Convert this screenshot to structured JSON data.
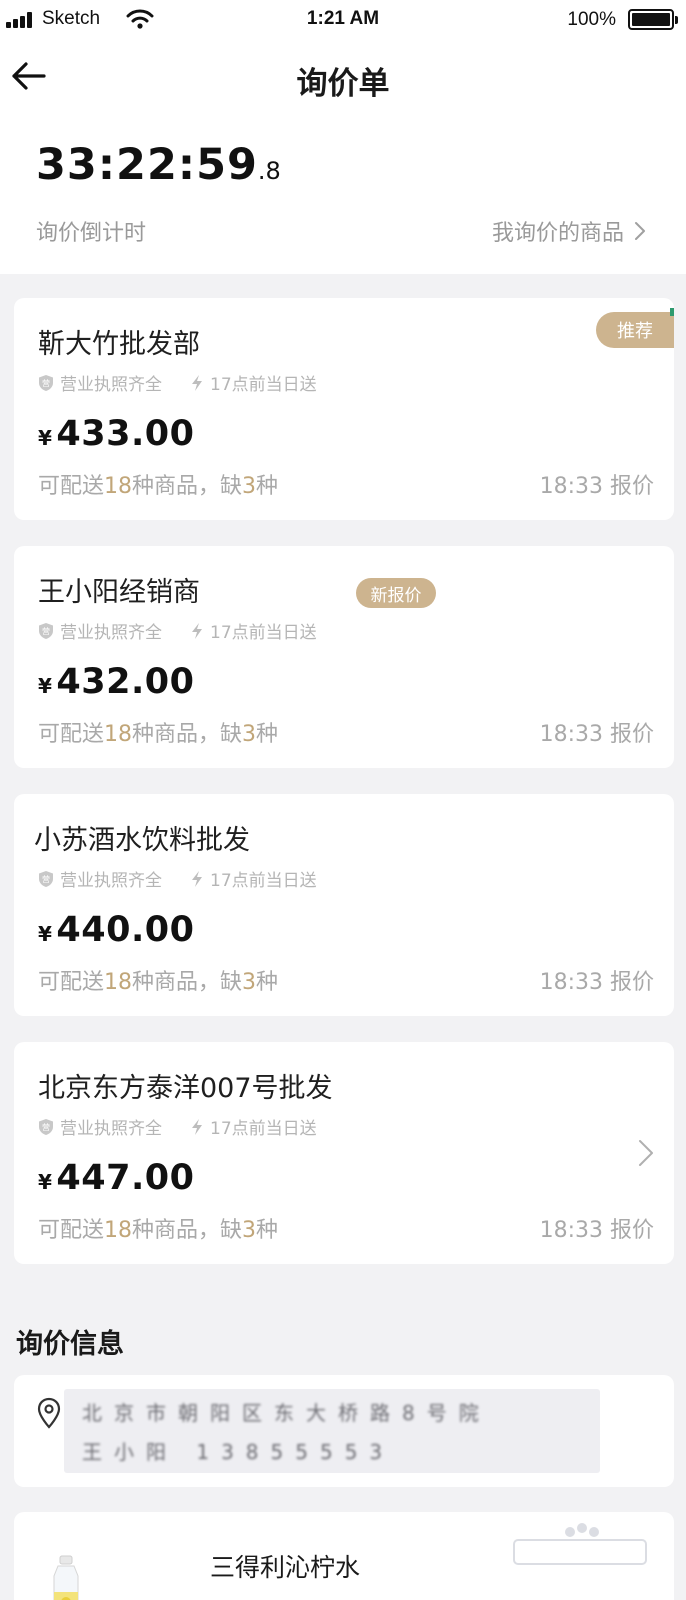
{
  "status_bar": {
    "carrier": "Sketch",
    "time": "1:21 AM",
    "battery": "100%"
  },
  "nav": {
    "title": "询价单"
  },
  "countdown": {
    "main": "33:22:59",
    "fraction": ".8",
    "label": "询价倒计时"
  },
  "my_goods_link": "我询价的商品",
  "suppliers": [
    {
      "name": "靳大竹批发部",
      "tag1": "营业执照齐全",
      "tag2": "17点前当日送",
      "currency": "¥",
      "price": "433.00",
      "delivery_prefix": "可配送",
      "delivery_count": "18",
      "delivery_mid": "种商品，缺",
      "missing_count": "3",
      "delivery_suffix": "种",
      "quote_time": "18:33 报价",
      "badge": "推荐"
    },
    {
      "name": "王小阳经销商",
      "tag1": "营业执照齐全",
      "tag2": "17点前当日送",
      "currency": "¥",
      "price": "432.00",
      "delivery_prefix": "可配送",
      "delivery_count": "18",
      "delivery_mid": "种商品，缺",
      "missing_count": "3",
      "delivery_suffix": "种",
      "quote_time": "18:33 报价",
      "badge": "新报价"
    },
    {
      "name": "小苏酒水饮料批发",
      "tag1": "营业执照齐全",
      "tag2": "17点前当日送",
      "currency": "¥",
      "price": "440.00",
      "delivery_prefix": "可配送",
      "delivery_count": "18",
      "delivery_mid": "种商品，缺",
      "missing_count": "3",
      "delivery_suffix": "种",
      "quote_time": "18:33 报价"
    },
    {
      "name": "北京东方泰洋007号批发",
      "tag1": "营业执照齐全",
      "tag2": "17点前当日送",
      "currency": "¥",
      "price": "447.00",
      "delivery_prefix": "可配送",
      "delivery_count": "18",
      "delivery_mid": "种商品，缺",
      "missing_count": "3",
      "delivery_suffix": "种",
      "quote_time": "18:33 报价"
    }
  ],
  "inquiry_info": {
    "title": "询价信息",
    "address_line1": "北京市朝阳区东大桥路8号院",
    "address_line2": "王小阳 13855553"
  },
  "product": {
    "name": "三得利沁柠水"
  },
  "icons": {
    "back": "arrow-left-icon",
    "chevron": "chevron-right-icon",
    "license": "shield-icon",
    "lightning": "lightning-icon",
    "pin": "location-pin-icon"
  },
  "colors": {
    "accent_gold": "#cdb48f",
    "number_gold": "#c1a679",
    "muted_text": "#a9a9a9"
  }
}
